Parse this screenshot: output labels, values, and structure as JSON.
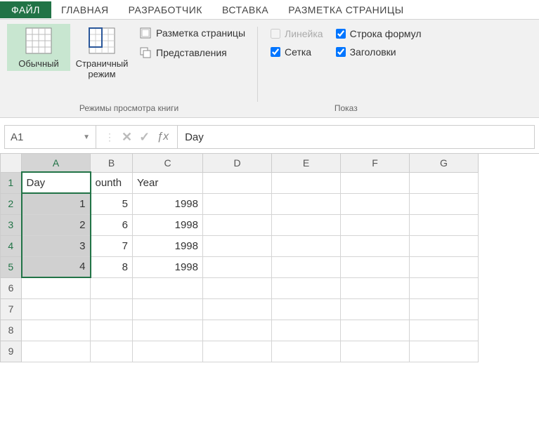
{
  "tabs": {
    "file": "ФАЙЛ",
    "home": "ГЛАВНАЯ",
    "developer": "Разработчик",
    "insert": "ВСТАВКА",
    "pagelayout": "РАЗМЕТКА СТРАНИЦЫ"
  },
  "ribbon": {
    "view_modes_group": "Режимы просмотра книги",
    "show_group": "Показ",
    "normal": "Обычный",
    "pagebreak": "Страничный режим",
    "pagelayout_btn": "Разметка страницы",
    "custom_views": "Представления",
    "ruler": "Линейка",
    "formula_bar": "Строка формул",
    "gridlines": "Сетка",
    "headings": "Заголовки"
  },
  "checkboxes": {
    "ruler": false,
    "formula_bar": true,
    "gridlines": true,
    "headings": true
  },
  "namebox": "A1",
  "formula_value": "Day",
  "columns": [
    "A",
    "B",
    "C",
    "D",
    "E",
    "F",
    "G"
  ],
  "rows": [
    "1",
    "2",
    "3",
    "4",
    "5",
    "6",
    "7",
    "8",
    "9"
  ],
  "selected_col": "A",
  "selection_rows": [
    "1",
    "2",
    "3",
    "4",
    "5"
  ],
  "active_cell": "A1",
  "cells": {
    "A1": "Day",
    "B1": "ounth",
    "C1": "Year",
    "A2": "1",
    "B2": "5",
    "C2": "1998",
    "A3": "2",
    "B3": "6",
    "C3": "1998",
    "A4": "3",
    "B4": "7",
    "C4": "1998",
    "A5": "4",
    "B5": "8",
    "C5": "1998"
  },
  "col_widths": {
    "A": 98,
    "B": 60,
    "C": 100,
    "D": 98,
    "E": 98,
    "F": 98,
    "G": 98
  }
}
